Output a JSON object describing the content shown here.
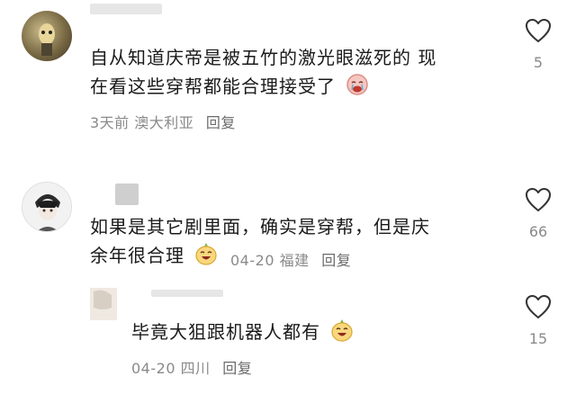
{
  "comments": [
    {
      "text_line1": "自从知道庆帝是被五竹的激光眼滋死的 现",
      "text_line2": "在看这些穿帮都能合理接受了",
      "emoji": "crying-face-emoji",
      "date": "3天前",
      "location": "澳大利亚",
      "reply_label": "回复",
      "likes": "5"
    },
    {
      "text_line1": "如果是其它剧里面，确实是穿帮，但是庆",
      "text_line2": "余年很合理",
      "emoji": "laughing-face-emoji",
      "date": "04-20",
      "location": "福建",
      "reply_label": "回复",
      "likes": "66"
    },
    {
      "text_line1": "毕竟大狙跟机器人都有",
      "emoji": "laughing-face-emoji",
      "date": "04-20",
      "location": "四川",
      "reply_label": "回复",
      "likes": "15"
    }
  ],
  "colors": {
    "text": "#1a1a1a",
    "meta": "#8a8a8a",
    "username_blur": "#d9d9d9"
  }
}
